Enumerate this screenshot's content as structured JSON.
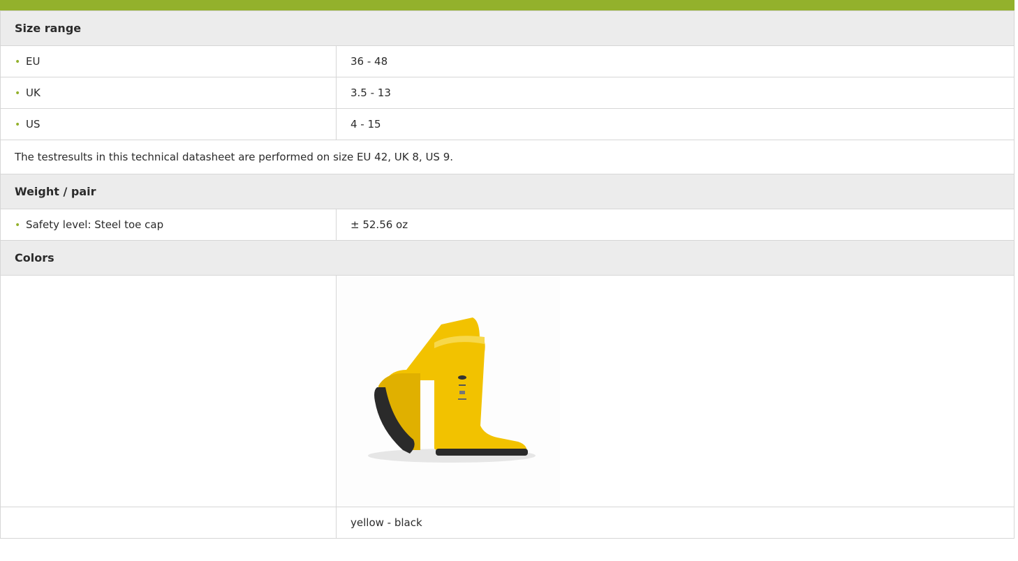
{
  "size_range": {
    "header": "Size range",
    "rows": [
      {
        "label": "EU",
        "value": "36 - 48"
      },
      {
        "label": "UK",
        "value": "3.5 - 13"
      },
      {
        "label": "US",
        "value": "4 - 15"
      }
    ],
    "note": "The testresults in this technical datasheet are performed on size EU 42, UK 8, US 9."
  },
  "weight": {
    "header": "Weight / pair",
    "rows": [
      {
        "label": "Safety level: Steel toe cap",
        "value": "± 52.56 oz"
      }
    ]
  },
  "colors": {
    "header": "Colors",
    "image_icon": "yellow-boot-image",
    "caption": "yellow - black"
  },
  "theme": {
    "accent": "#93b12c",
    "header_bg": "#ececec",
    "boot_yellow": "#f2c200",
    "sole_black": "#2a2a2a"
  }
}
